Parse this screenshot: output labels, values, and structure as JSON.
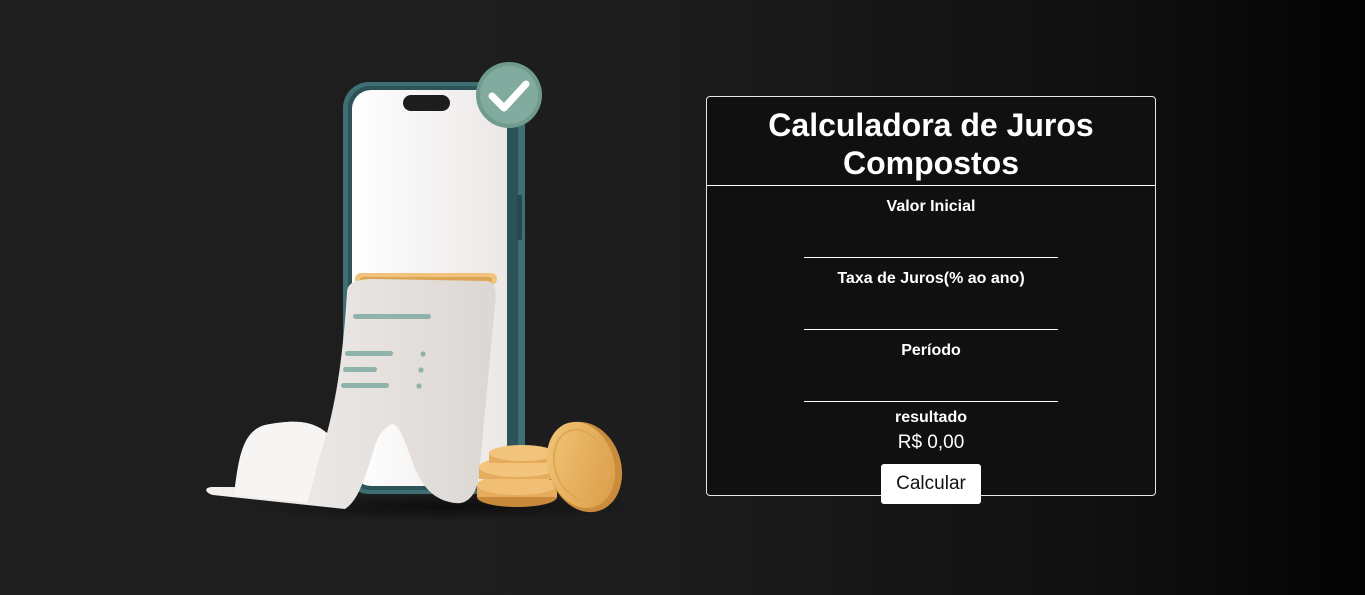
{
  "page": {
    "background_color": "#1d1d1d"
  },
  "illustration": {
    "icon": "phone-receipt-coins-illustration",
    "accent_color": "#7ea99c"
  },
  "calculator": {
    "title": "Calculadora de Juros Compostos",
    "fields": [
      {
        "label": "Valor Inicial",
        "value": ""
      },
      {
        "label": "Taxa de Juros(% ao ano)",
        "value": ""
      },
      {
        "label": "Período",
        "value": ""
      }
    ],
    "result_label": "resultado",
    "result_value": "R$ 0,00",
    "button_label": "Calcular"
  }
}
